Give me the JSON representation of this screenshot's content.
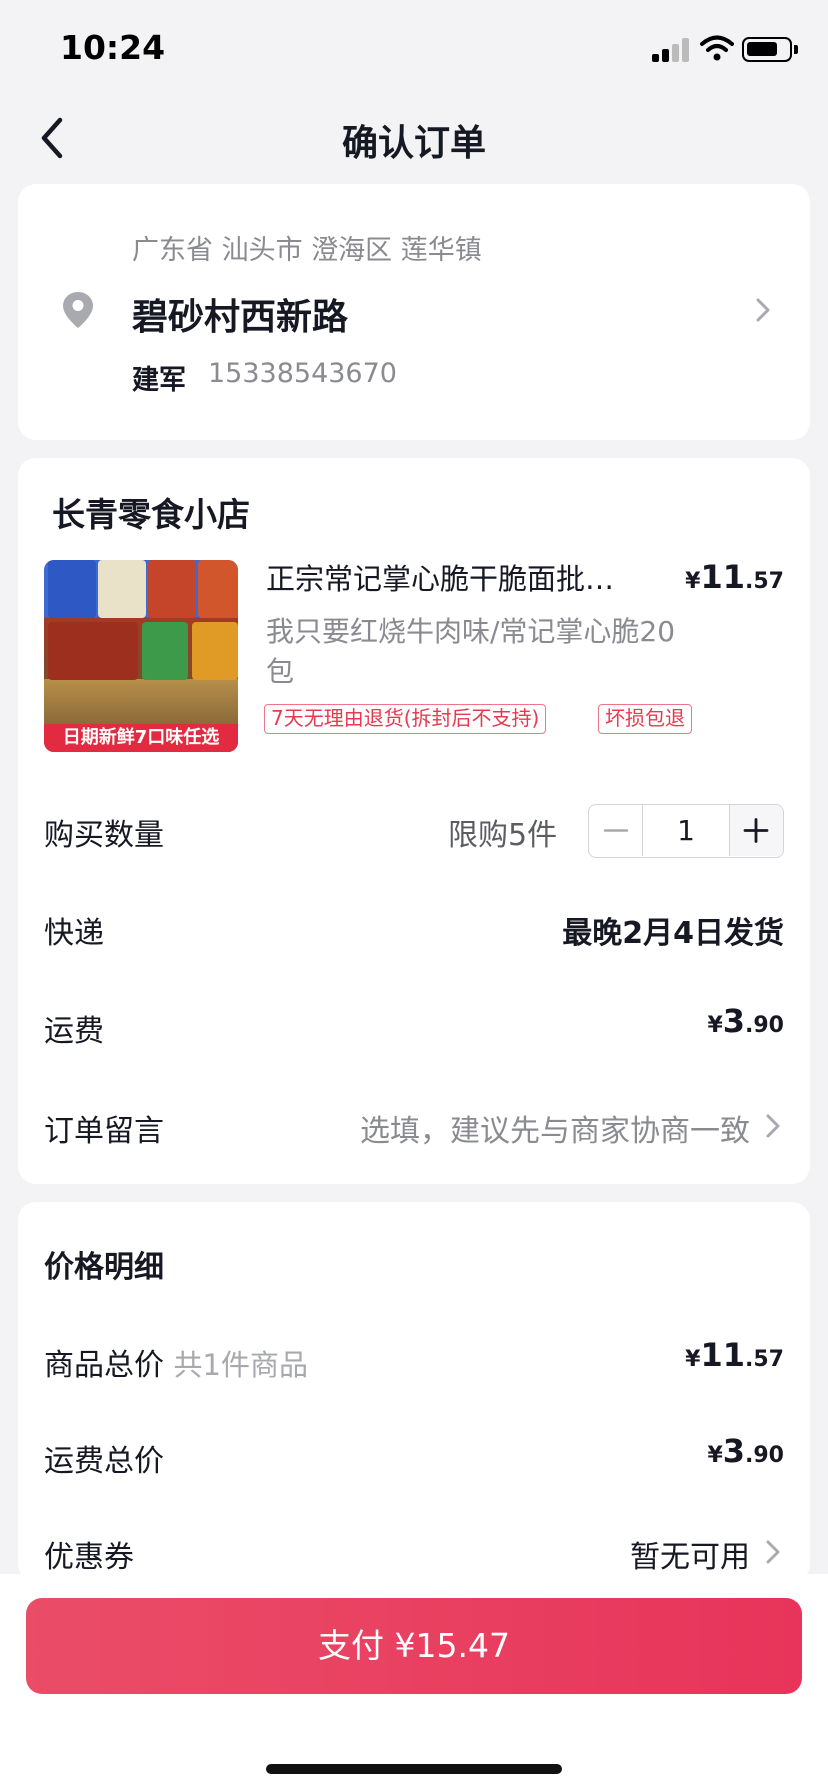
{
  "status_bar": {
    "time": "10:24"
  },
  "nav": {
    "title": "确认订单"
  },
  "address": {
    "region": "广东省 汕头市 澄海区 莲华镇",
    "street": "碧砂村西新路",
    "name": "建军",
    "phone": "15338543670"
  },
  "order": {
    "shop_name": "长青零食小店",
    "product": {
      "title": "正宗常记掌心脆干脆面批…",
      "price_symbol": "¥",
      "price_int": "11",
      "price_dec": ".57",
      "spec": "我只要红烧牛肉味/常记掌心脆20包",
      "image_banner": "日期新鲜7口味任选",
      "tags": [
        "7天无理由退货(拆封后不支持)",
        "坏损包退"
      ]
    },
    "quantity": {
      "label": "购买数量",
      "limit": "限购5件",
      "value": "1"
    },
    "shipping": {
      "label": "快递",
      "value": "最晚2月4日发货"
    },
    "freight": {
      "label": "运费",
      "symbol": "¥",
      "int": "3",
      "dec": ".90"
    },
    "note": {
      "label": "订单留言",
      "placeholder": "选填，建议先与商家协商一致"
    }
  },
  "price_detail": {
    "heading": "价格明细",
    "goods_total": {
      "label": "商品总价",
      "hint": "共1件商品",
      "symbol": "¥",
      "int": "11",
      "dec": ".57"
    },
    "freight_total": {
      "label": "运费总价",
      "symbol": "¥",
      "int": "3",
      "dec": ".90"
    },
    "coupon": {
      "label": "优惠券",
      "value": "暂无可用"
    }
  },
  "pay": {
    "label": "支付 ¥15.47"
  },
  "colors": {
    "accent": "#e8345a",
    "tag": "#e8394f"
  },
  "icons": [
    "back-icon",
    "location-pin-icon",
    "chevron-right-icon",
    "minus-icon",
    "plus-icon",
    "wifi-icon",
    "signal-icon",
    "battery-icon"
  ]
}
